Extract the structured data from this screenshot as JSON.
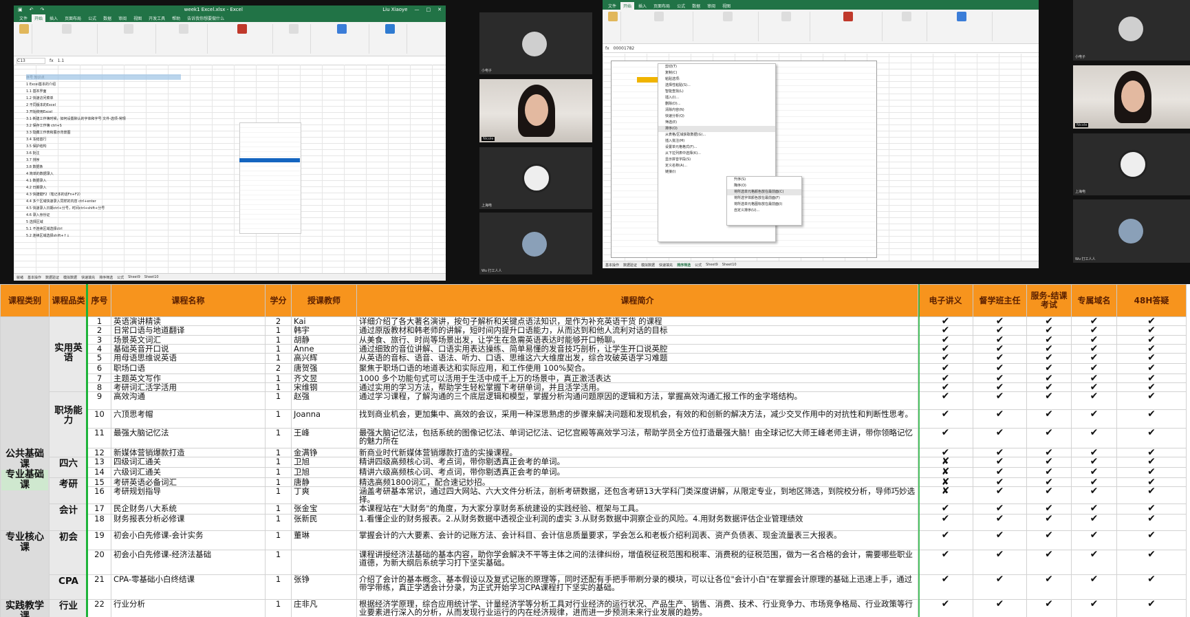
{
  "left_excel": {
    "title": "week1 Excel.xlsx - Excel",
    "user": "Liu Xiaoye",
    "tabs": [
      "文件",
      "开始",
      "插入",
      "页面布局",
      "公式",
      "数据",
      "审阅",
      "视图",
      "开发工具",
      "帮助",
      "告诉我你想要做什么"
    ],
    "formula_ref": "C13",
    "formula_val": "1.1",
    "col_headers": [
      "A",
      "B",
      "C",
      "D",
      "E",
      "F",
      "G",
      "H",
      "I",
      "J",
      "K",
      "L"
    ],
    "rows": [
      "序号  知识点",
      "1    Excel基本的介绍",
      "1.1  基本界面",
      "1.2  快速访问菜单",
      "2    不同版本的Excel",
      "3    开始使用Excel",
      "3.1  新建工作簿时候，如何设置默认的字体和字号      文件-选项-常规",
      "3.2  保存工作簿 ctrl+S",
      "3.3  隐藏工作表和展示背景图",
      "3.4  冻结首行",
      "3.5  保护结构",
      "3.6  批注",
      "3.7  排序",
      "3.8  数据条",
      "4    简单的数据录入",
      "4.1  数据录入",
      "4.2  日期录入",
      "4.3  快捷键F2（笔记本的话Fn+F2）",
      "4.4  多个区域快速录入同样的内容 ctrl+enter",
      "4.5  快速录入日期ctrl+分号，时间ctrl+shift+分号",
      "4.6  录入身份证",
      "5    选择区域",
      "5.1  不连续区域选择ctrl",
      "5.2  连续区域选择shift+↑↓"
    ],
    "sheets": [
      "基本操作",
      "数据验证",
      "模拟数据",
      "快速填充",
      "排序筛选",
      "公式",
      "Sheet9",
      "Sheet10"
    ],
    "status": "就绪"
  },
  "right_excel": {
    "name_box": "00001782",
    "sheets": [
      "基本操作",
      "数据验证",
      "模拟数据",
      "快速填充",
      "排序筛选",
      "公式",
      "Sheet9",
      "Sheet10"
    ],
    "context_menu": [
      "剪切(T)",
      "复制(C)",
      "粘贴选项:",
      "选择性粘贴(S)...",
      "智能查找(L)",
      "插入(I)...",
      "删除(D)...",
      "清除内容(N)",
      "快速分析(Q)",
      "筛选(E)",
      "排序(O)",
      "从表格/区域获取数据(G)...",
      "插入批注(M)",
      "设置单元格格式(F)...",
      "从下拉列表中选择(K)...",
      "显示拼音字段(S)",
      "定义名称(A)...",
      "链接(I)"
    ],
    "submenu": [
      "升序(S)",
      "降序(O)",
      "将所选单元格颜色放在最前面(C)",
      "将所选字体颜色放在最前面(F)",
      "将所选单元格图标放在最前面(I)",
      "自定义排序(U)..."
    ]
  },
  "participants": {
    "tile1_name": "小电子",
    "tile2_name": "Nicole",
    "tile3_name": "上海电",
    "tile4_name": "Wu 打工人人",
    "r_tile1_name": "小电子",
    "r_tile2_name": "Nicole",
    "r_tile3_name": "上海电",
    "r_tile4_name": "Wu 打工人人"
  },
  "course_table": {
    "headers": [
      "课程类别",
      "课程品类",
      "序号",
      "课程名称",
      "学分",
      "授课教师",
      "课程简介",
      "电子讲义",
      "督学班主任",
      "服务-结课考试",
      "专属域名",
      "48H答疑"
    ],
    "category_public": "公共基础课",
    "category_major_basic": "专业基础课",
    "category_major_core": "专业核心课",
    "category_practice": "实践教学课",
    "sub_english": "实用英语",
    "sub_workplace": "职场能力",
    "sub_cet": "四六",
    "sub_kaoyan": "考研",
    "sub_accounting": "会计",
    "sub_chuhui": "初会",
    "sub_cpa": "CPA",
    "sub_industry": "行业",
    "rows": [
      {
        "no": "1",
        "name": "英语演讲精读",
        "credit": "2",
        "teacher": "Kai",
        "intro": "详细介绍了各大著名演讲，按句子解析和关键点语法知识，是作为补充英语干货 的课程",
        "m": [
          "✔",
          "✔",
          "✔",
          "✔",
          "✔"
        ]
      },
      {
        "no": "2",
        "name": "日常口语与地道翻译",
        "credit": "1",
        "teacher": "韩宇",
        "intro": "通过原版教材和韩老师的讲解，短时间内提升口语能力，从而达到和他人流利对话的目标",
        "m": [
          "✔",
          "✔",
          "✔",
          "✔",
          "✔"
        ]
      },
      {
        "no": "3",
        "name": "场景英文词汇",
        "credit": "1",
        "teacher": "胡静",
        "intro": "从美食、旅行、时尚等场景出发，让学生在急需英语表达时能够开口畅聊。",
        "m": [
          "✔",
          "✔",
          "✔",
          "✔",
          "✔"
        ]
      },
      {
        "no": "4",
        "name": "基础英音开口说",
        "credit": "1",
        "teacher": "Anne",
        "intro": "通过细致的音位讲解、口语实用表达操练、简单易懂的发音技巧剖析，让学生开口说英腔",
        "m": [
          "✔",
          "✔",
          "✔",
          "✔",
          "✔"
        ]
      },
      {
        "no": "5",
        "name": "用母语思维说英语",
        "credit": "1",
        "teacher": "高兴辉",
        "intro": "从英语的音标、语音、语法、听力、口语、思维这六大维度出发，综合攻破英语学习难题",
        "m": [
          "✔",
          "✔",
          "✔",
          "✔",
          "✔"
        ]
      },
      {
        "no": "6",
        "name": "职场口语",
        "credit": "2",
        "teacher": "唐贺强",
        "intro": "聚焦于职场口语的地道表达和实际应用，和工作使用 100%契合。",
        "m": [
          "✔",
          "✔",
          "✔",
          "✔",
          "✔"
        ]
      },
      {
        "no": "7",
        "name": "主题英文写作",
        "credit": "1",
        "teacher": "齐文昱",
        "intro": "1000 多个功能句式可以活用于生活中成千上万的场景中，真正激活表达",
        "m": [
          "✔",
          "✔",
          "✔",
          "✔",
          "✔"
        ]
      },
      {
        "no": "8",
        "name": "考研词汇活学活用",
        "credit": "1",
        "teacher": "宋维钢",
        "intro": "通过实用的学习方法，帮助学生轻松掌握下考研单词，并且活学活用。",
        "m": [
          "✔",
          "✔",
          "✔",
          "✔",
          "✔"
        ]
      },
      {
        "no": "9",
        "name": "高效沟通",
        "credit": "1",
        "teacher": "赵强",
        "intro": "通过学习课程，了解沟通的三个底层逻辑和模型，掌握分析沟通问题原因的逻辑和方法，掌握高效沟通汇报工作的金字塔结构。",
        "m": [
          "✔",
          "✔",
          "✔",
          "✔",
          "✔"
        ]
      },
      {
        "no": "10",
        "name": "六顶思考帽",
        "credit": "1",
        "teacher": "Joanna",
        "intro": "找到商业机会，更加集中、高效的会议，采用一种深思熟虑的步骤来解决问题和发现机会，有效的和创新的解决方法，减少交叉作用中的对抗性和判断性思考。",
        "m": [
          "✔",
          "✔",
          "✔",
          "✔",
          "✔"
        ]
      },
      {
        "no": "11",
        "name": "最强大脑记忆法",
        "credit": "1",
        "teacher": "王峰",
        "intro": "最强大脑记忆法，包括系统的图像记忆法、单词记忆法、记忆宫殿等高效学习法，帮助学员全方位打造最强大脑！由全球记忆大师王峰老师主讲，带你领略记忆的魅力所在",
        "m": [
          "✔",
          "✔",
          "✔",
          "✔",
          "✔"
        ]
      },
      {
        "no": "12",
        "name": "新媒体营销爆款打造",
        "credit": "1",
        "teacher": "金满铮",
        "intro": "新商业时代新媒体营销爆款打造的实操课程。",
        "m": [
          "✔",
          "✔",
          "✔",
          "✔",
          "✔"
        ]
      },
      {
        "no": "13",
        "name": "四级词汇通关",
        "credit": "1",
        "teacher": "卫旭",
        "intro": "精讲四级高频核心词、考点词，带你剔透真正会考的单词。",
        "m": [
          "✘",
          "✔",
          "✔",
          "✔",
          "✔"
        ]
      },
      {
        "no": "14",
        "name": "六级词汇通关",
        "credit": "1",
        "teacher": "卫旭",
        "intro": "精讲六级高频核心词、考点词，带你剔透真正会考的单词。",
        "m": [
          "✘",
          "✔",
          "✔",
          "✔",
          "✔"
        ]
      },
      {
        "no": "15",
        "name": "考研英语必备词汇",
        "credit": "1",
        "teacher": "唐静",
        "intro": "精选高频1800词汇，配合速记妙招。",
        "m": [
          "✘",
          "✔",
          "✔",
          "✔",
          "✔"
        ]
      },
      {
        "no": "16",
        "name": "考研规划指导",
        "credit": "1",
        "teacher": "丁爽",
        "intro": "涵盖考研基本常识，通过四大网站、六大文件分析法，剖析考研数据，还包含考研13大学科门类深度讲解，从限定专业，到地区筛选，到院校分析，导师巧妙选择。",
        "m": [
          "✘",
          "✔",
          "✔",
          "✔",
          "✔"
        ]
      },
      {
        "no": "17",
        "name": "民企财务八大系统",
        "credit": "1",
        "teacher": "张金宝",
        "intro": "本课程站在\"大财务\"的角度，为大家分享财务系统建设的实践经验、框架与工具。",
        "m": [
          "✔",
          "✔",
          "✔",
          "✔",
          "✔"
        ]
      },
      {
        "no": "18",
        "name": "财务报表分析必修课",
        "credit": "1",
        "teacher": "张新民",
        "intro": "1.看懂企业的财务报表。2.从财务数据中透视企业利润的虚实 3.从财务数据中洞察企业的风险。4.用财务数据评估企业管理绩效",
        "m": [
          "✔",
          "✔",
          "✔",
          "✔",
          "✔"
        ]
      },
      {
        "no": "19",
        "name": "初会小白先修课-会计实务",
        "credit": "1",
        "teacher": "董琳",
        "intro": "掌握会计的六大要素、会计的记账方法、会计科目、会计信息质量要求，学会怎么和老板介绍利润表、资产负债表、现金流量表三大报表。",
        "m": [
          "✔",
          "✔",
          "✔",
          "✔",
          "✔"
        ]
      },
      {
        "no": "20",
        "name": "初会小白先修课-经济法基础",
        "credit": "1",
        "teacher": "",
        "intro": "课程讲授经济法基础的基本内容，助你学会解决不平等主体之间的法律纠纷，增值税征税范围和税率、消费税的征税范围，做为一名合格的会计，需要哪些职业道德，为新大纲后系统学习打下坚实基础。",
        "m": [
          "✔",
          "✔",
          "✔",
          "✔",
          "✔"
        ]
      },
      {
        "no": "21",
        "name": "CPA-零基础小白终结课",
        "credit": "1",
        "teacher": "张铮",
        "intro": "介绍了会计的基本概念、基本假设以及复式记账的原理等，同时还配有手把手带刷分录的模块，可以让各位\"会计小白\"在掌握会计原理的基础上迅速上手，通过带学带练，真正学透会计分录，为正式开始学习CPA课程打下坚实的基础。",
        "m": [
          "✔",
          "✔",
          "✔",
          "✔",
          "✔"
        ]
      },
      {
        "no": "22",
        "name": "行业分析",
        "credit": "1",
        "teacher": "庄非凡",
        "intro": "根据经济学原理，综合应用统计学、计量经济学等分析工具对行业经济的运行状况、产品生产、销售、消费、技术、行业竞争力、市场竞争格局、行业政策等行业要素进行深入的分析，从而发现行业运行的内在经济规律，进而进一步预测未来行业发展的趋势。",
        "m": [
          "✔",
          "✔",
          "✔",
          "✔",
          "✔"
        ]
      }
    ]
  },
  "colors": {
    "header_orange": "#f7941d",
    "excel_green": "#217346",
    "category_gray": "#dcdcdc"
  }
}
